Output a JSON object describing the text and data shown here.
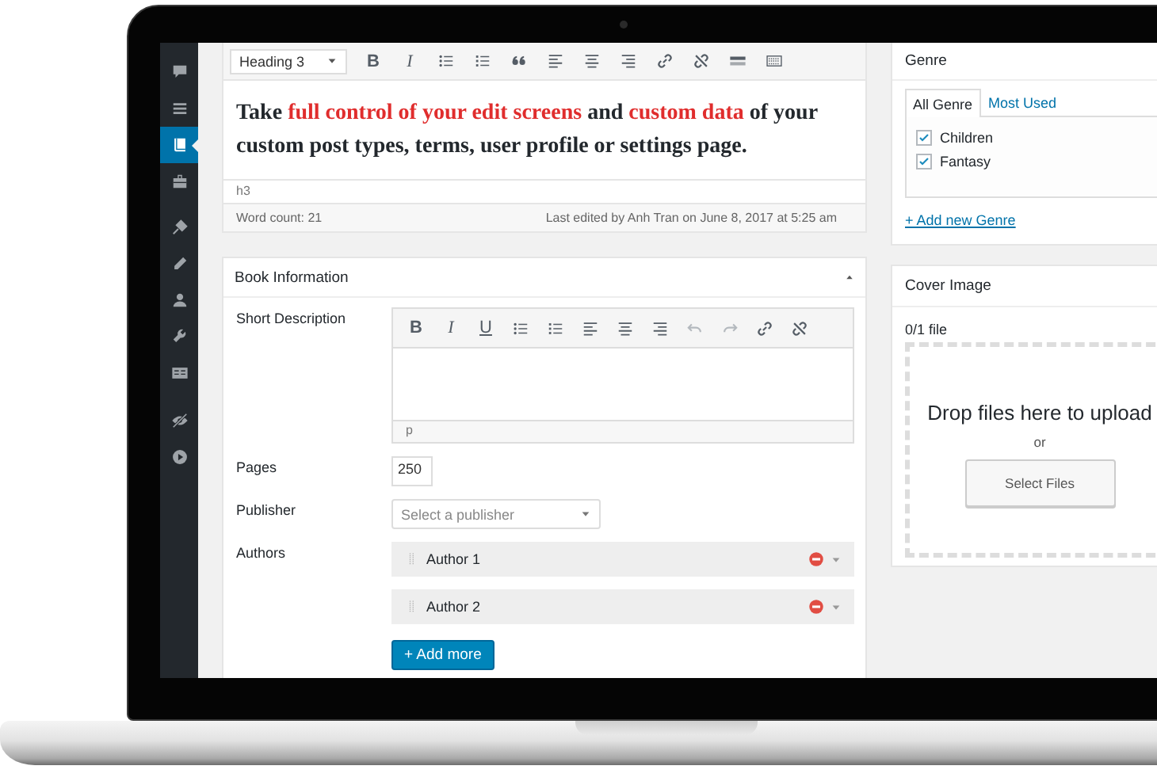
{
  "sidebar": {
    "items": [
      {
        "selected": false
      },
      {
        "selected": false
      },
      {
        "selected": true
      },
      {
        "selected": false
      },
      {
        "selected": false
      },
      {
        "selected": false
      },
      {
        "selected": false
      },
      {
        "selected": false
      },
      {
        "selected": false
      },
      {
        "selected": false
      },
      {
        "selected": false
      }
    ]
  },
  "editor": {
    "format_select": "Heading 3",
    "toolbar": [
      {
        "kind": "bold",
        "label": "B"
      },
      {
        "kind": "italic",
        "label": "I"
      },
      {
        "kind": "bullet-list"
      },
      {
        "kind": "numbered-list"
      },
      {
        "kind": "quote"
      },
      {
        "kind": "align-left"
      },
      {
        "kind": "align-center"
      },
      {
        "kind": "align-right"
      },
      {
        "kind": "link"
      },
      {
        "kind": "unlink"
      },
      {
        "kind": "more"
      },
      {
        "kind": "toolbar-toggle"
      }
    ],
    "content": [
      {
        "text": "Take ",
        "highlight": false
      },
      {
        "text": "full control of your edit screens",
        "highlight": true
      },
      {
        "text": " and ",
        "highlight": false
      },
      {
        "text": "custom data",
        "highlight": true
      },
      {
        "text": " of your custom post types, terms, user profile or settings page.",
        "highlight": false
      }
    ],
    "path": "h3",
    "word_count": "Word count: 21",
    "last_edited": "Last edited by Anh Tran on June 8, 2017 at 5:25 am"
  },
  "book_information": {
    "title": "Book Information",
    "fields": [
      {
        "kind": "wysiwyg",
        "label": "Short Description",
        "path": "p",
        "toolbar": [
          {
            "kind": "bold",
            "label": "B",
            "disabled": false
          },
          {
            "kind": "italic",
            "label": "I",
            "disabled": false
          },
          {
            "kind": "underline",
            "label": "U",
            "disabled": false
          },
          {
            "kind": "bullet-list",
            "disabled": false
          },
          {
            "kind": "numbered-list",
            "disabled": false
          },
          {
            "kind": "align-left",
            "disabled": false
          },
          {
            "kind": "align-center",
            "disabled": false
          },
          {
            "kind": "align-right",
            "disabled": false
          },
          {
            "kind": "undo",
            "disabled": true
          },
          {
            "kind": "redo",
            "disabled": true
          },
          {
            "kind": "link",
            "disabled": false
          },
          {
            "kind": "unlink",
            "disabled": false
          }
        ]
      },
      {
        "kind": "number",
        "label": "Pages",
        "value": "250"
      },
      {
        "kind": "select",
        "label": "Publisher",
        "placeholder": "Select a publisher"
      },
      {
        "kind": "group",
        "label": "Authors",
        "items": [
          "Author 1",
          "Author 2"
        ],
        "add_button": "+ Add more"
      }
    ]
  },
  "genre": {
    "title": "Genre",
    "tabs": [
      {
        "label": "All Genre",
        "selected": true
      },
      {
        "label": "Most Used",
        "selected": false
      }
    ],
    "terms": [
      {
        "label": "Children",
        "checked": true
      },
      {
        "label": "Fantasy",
        "checked": true
      }
    ],
    "add_link": "+ Add new Genre"
  },
  "cover_image": {
    "title": "Cover Image",
    "count": "0/1 file",
    "drop_text": "Drop files here to upload",
    "or": "or",
    "button": "Select Files"
  }
}
